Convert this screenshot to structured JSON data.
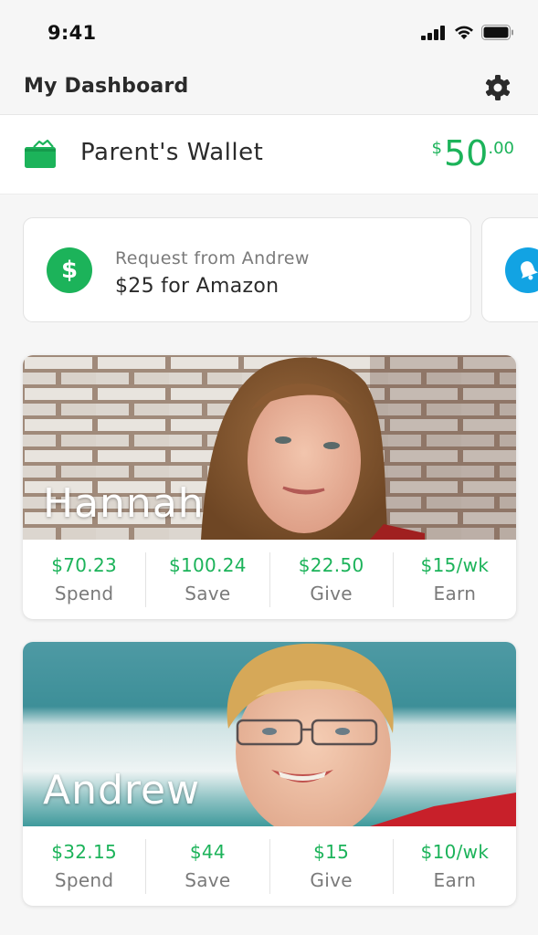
{
  "status_bar": {
    "time": "9:41",
    "icons": [
      "cellular-signal-icon",
      "wifi-icon",
      "battery-icon"
    ]
  },
  "header": {
    "title": "My Dashboard",
    "settings_icon": "gear-icon"
  },
  "wallet": {
    "icon": "wallet-icon",
    "label": "Parent's Wallet",
    "currency": "$",
    "amount_whole": "50",
    "amount_cents": ".00",
    "accent_color": "#1cb35a"
  },
  "requests": [
    {
      "icon": "dollar-icon",
      "icon_symbol": "$",
      "icon_color": "#1cb35a",
      "title": "Request from Andrew",
      "subtitle": "$25 for Amazon"
    },
    {
      "icon": "bell-icon",
      "icon_color": "#12a3e3"
    }
  ],
  "children": [
    {
      "name": "Hannah",
      "stats": [
        {
          "value": "$70.23",
          "label": "Spend"
        },
        {
          "value": "$100.24",
          "label": "Save"
        },
        {
          "value": "$22.50",
          "label": "Give"
        },
        {
          "value": "$15/wk",
          "label": "Earn"
        }
      ]
    },
    {
      "name": "Andrew",
      "stats": [
        {
          "value": "$32.15",
          "label": "Spend"
        },
        {
          "value": "$44",
          "label": "Save"
        },
        {
          "value": "$15",
          "label": "Give"
        },
        {
          "value": "$10/wk",
          "label": "Earn"
        }
      ]
    }
  ]
}
